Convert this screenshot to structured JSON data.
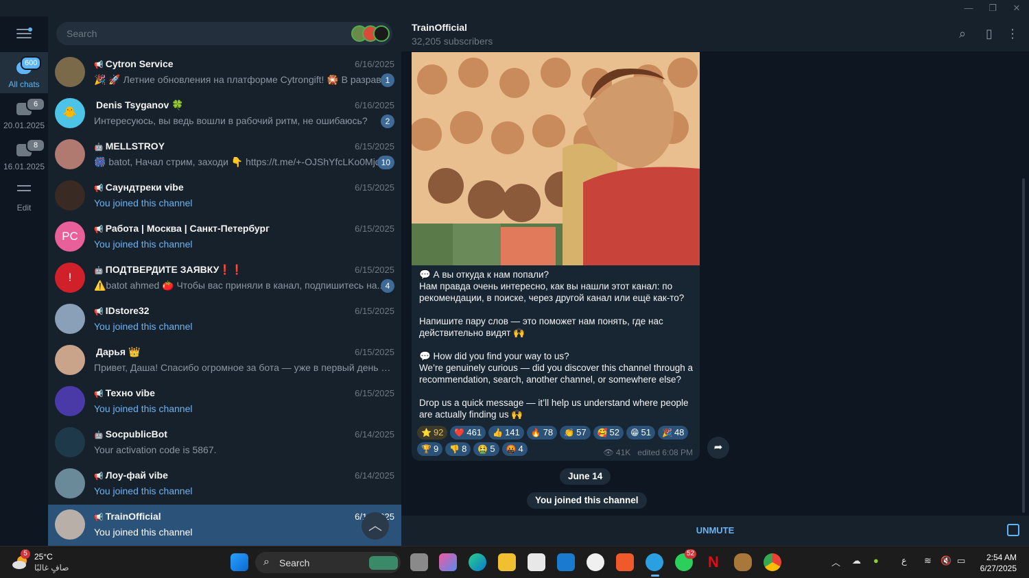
{
  "window": {
    "minimize": "—",
    "restore": "❐",
    "close": "✕"
  },
  "rail": {
    "folders": [
      {
        "label": "All chats",
        "badge": "600"
      },
      {
        "label": "20.01.2025",
        "badge": "6"
      },
      {
        "label": "16.01.2025",
        "badge": "8"
      }
    ],
    "edit_label": "Edit"
  },
  "search": {
    "placeholder": "Search"
  },
  "chats": [
    {
      "name": "Cytron Service",
      "type": "📢",
      "date": "6/16/2025",
      "message": "🎉 🚀 Летние обновления на платформе Cytrongift! 🎇 В разрав...",
      "badge": "1",
      "avatar_text": "",
      "avatar_color": "#7a6a4a"
    },
    {
      "name": "Denis Tsyganov 🍀",
      "type": "",
      "date": "6/16/2025",
      "message": "Интересуюсь, вы ведь вошли в рабочий ритм, не ошибаюсь?",
      "badge": "2",
      "avatar_text": "🐥",
      "avatar_color": "#4cc4e8"
    },
    {
      "name": "MELLSTROY",
      "type": "🤖",
      "date": "6/15/2025",
      "message": "🎆 batot, Начал стрим, заходи 👇 https://t.me/+-OJShYfcLKo0Mjdi",
      "badge": "10",
      "avatar_text": "",
      "avatar_color": "#b07a70"
    },
    {
      "name": "Саундтреки vibe",
      "type": "📢",
      "date": "6/15/2025",
      "message": "You joined this channel",
      "badge": "",
      "avatar_text": "",
      "avatar_color": "#3a2a24"
    },
    {
      "name": "Работа | Москва | Санкт-Петербург",
      "type": "📢",
      "date": "6/15/2025",
      "message": "You joined this channel",
      "badge": "",
      "avatar_text": "PC",
      "avatar_color": "#e8609a"
    },
    {
      "name": "ПОДТВЕРДИТЕ ЗАЯВКУ❗️❗️",
      "type": "🤖",
      "date": "6/15/2025",
      "message": "⚠️batot ahmed 🍅 Чтобы вас приняли в канал, подпишитесь на...",
      "badge": "4",
      "avatar_text": "!",
      "avatar_color": "#d0202a"
    },
    {
      "name": "IDstore32",
      "type": "📢",
      "date": "6/15/2025",
      "message": "You joined this channel",
      "badge": "",
      "avatar_text": "",
      "avatar_color": "#8aa0b8"
    },
    {
      "name": "Дарья 👑",
      "type": "",
      "date": "6/15/2025",
      "message": "Привет, Даша! Спасибо огромное за бота — уже в первый день получ...",
      "badge": "",
      "avatar_text": "",
      "avatar_color": "#c9a48a"
    },
    {
      "name": "Техно vibe",
      "type": "📢",
      "date": "6/15/2025",
      "message": "You joined this channel",
      "badge": "",
      "avatar_text": "",
      "avatar_color": "#4a3aa8"
    },
    {
      "name": "SocpublicBot",
      "type": "🤖",
      "date": "6/14/2025",
      "message": "Your activation code is 5867.",
      "badge": "",
      "avatar_text": "",
      "avatar_color": "#1e3a4a"
    },
    {
      "name": "Лоу-фай vibe",
      "type": "📢",
      "date": "6/14/2025",
      "message": "You joined this channel",
      "badge": "",
      "avatar_text": "",
      "avatar_color": "#6a8a9a"
    },
    {
      "name": "TrainOfficial",
      "type": "📢",
      "date": "6/14/2025",
      "message": "You joined this channel",
      "badge": "",
      "avatar_text": "",
      "avatar_color": "#b8b0a8"
    }
  ],
  "header": {
    "title": "TrainOfficial",
    "subtitle": "32,205 subscribers"
  },
  "post": {
    "text": "💬 А вы откуда к нам попали?\nНам правда очень интересно, как вы нашли этот канал: по рекомендации, в поиске, через другой канал или ещё как-то?\n\nНапишите пару слов — это поможет нам понять, где нас действительно видят 🙌\n\n💬 How did you find your way to us?\nWe’re genuinely curious — did you discover this channel through a recommendation, search, another channel, or somewhere else?\n\nDrop us a quick message — it’ll help us understand where people are actually finding us 🙌",
    "reactions": [
      {
        "emoji": "⭐",
        "count": "92"
      },
      {
        "emoji": "❤️",
        "count": "461"
      },
      {
        "emoji": "👍",
        "count": "141"
      },
      {
        "emoji": "🔥",
        "count": "78"
      },
      {
        "emoji": "👏",
        "count": "57"
      },
      {
        "emoji": "🥰",
        "count": "52"
      },
      {
        "emoji": "😁",
        "count": "51"
      },
      {
        "emoji": "🎉",
        "count": "48"
      },
      {
        "emoji": "🏆",
        "count": "9"
      },
      {
        "emoji": "👎",
        "count": "8"
      },
      {
        "emoji": "🤮",
        "count": "5"
      },
      {
        "emoji": "🤬",
        "count": "4"
      }
    ],
    "views": "41K",
    "edited": "edited 6:08 PM"
  },
  "service": {
    "date": "June 14",
    "joined": "You joined this channel"
  },
  "bottom": {
    "unmute": "UNMUTE"
  },
  "taskbar": {
    "weather_temp": "25°C",
    "weather_desc": "صافٍ غالبًا",
    "weather_badge": "5",
    "search_label": "Search",
    "whatsapp_badge": "52",
    "lang": "ع",
    "time": "2:54 AM",
    "date": "6/27/2025"
  }
}
